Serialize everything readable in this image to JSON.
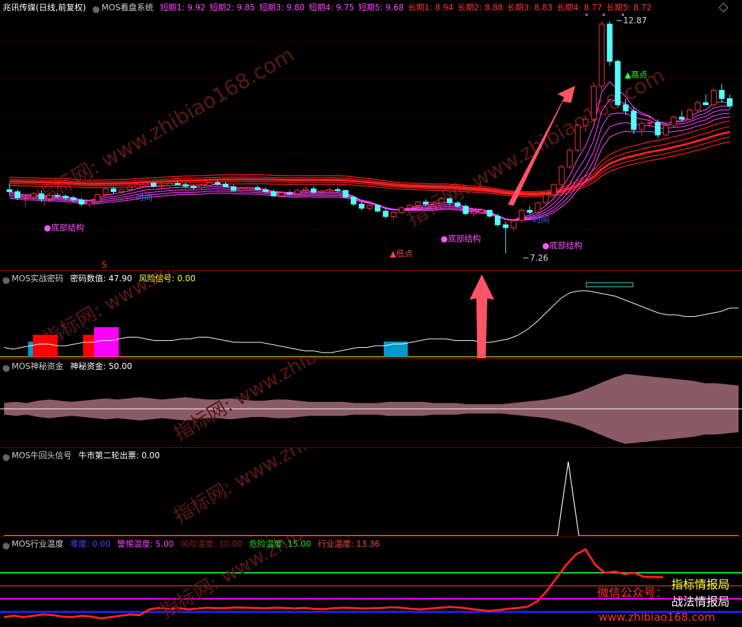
{
  "title": {
    "stock": "兆讯传媒(日线,前复权)",
    "indicator": "MOS看盘系统"
  },
  "ma_labels": [
    {
      "label": "短期1: 9.92",
      "color": "#ff44ff"
    },
    {
      "label": "短期2: 9.85",
      "color": "#ff44ff"
    },
    {
      "label": "短期3: 9.80",
      "color": "#ff44ff"
    },
    {
      "label": "短期4: 9.75",
      "color": "#ff44ff"
    },
    {
      "label": "短期5: 9.68",
      "color": "#ff44ff"
    },
    {
      "label": "长期1: 8.94",
      "color": "#ff3333"
    },
    {
      "label": "长期2: 8.88",
      "color": "#ff3333"
    },
    {
      "label": "长期3: 8.83",
      "color": "#ff3333"
    },
    {
      "label": "长期4: 8.77",
      "color": "#ff3333"
    },
    {
      "label": "长期5: 8.72",
      "color": "#ff3333"
    }
  ],
  "annotations": {
    "high_value": "12.87",
    "low_value": "7.26",
    "high_point": "▲高点",
    "low_point": "▲低点",
    "bottom_structure": "●底部结构",
    "time_label": "时间",
    "s_mark": "S"
  },
  "panels": {
    "p2": {
      "name": "MOS实战密码",
      "l1": "密码数值: 47.90",
      "l2": "风险信号: 0.00"
    },
    "p3": {
      "name": "MOS神秘资金",
      "l1": "神秘资金: 50.00"
    },
    "p4": {
      "name": "MOS牛回头信号",
      "l1": "牛市第二轮出票: 0.00"
    },
    "p5": {
      "name": "MOS行业温度",
      "l1": "零度: 0.00",
      "l2": "警惕温度: 5.00",
      "l3": "风险温度: 10.00",
      "l4": "危险温度: 15.00",
      "l5": "行业温度: 13.36"
    }
  },
  "watermarks": {
    "main": "指标网: www.zhibiao168.com",
    "wechat": "微信公众号：",
    "brand1": "指标情报局",
    "brand2": "战法情报局",
    "url": "www.zhibiao168.com"
  },
  "colors": {
    "up": "#ff3333",
    "down": "#54fcfc",
    "short_ma": "#ff44ff",
    "long_ma": "#ff2020",
    "bg": "#000000"
  },
  "chart_data": [
    {
      "type": "candlestick",
      "candles_ohlc": [
        [
          8.8,
          8.95,
          8.65,
          8.75
        ],
        [
          8.75,
          8.8,
          8.55,
          8.6
        ],
        [
          8.6,
          8.7,
          8.4,
          8.62
        ],
        [
          8.62,
          8.75,
          8.55,
          8.7
        ],
        [
          8.7,
          8.78,
          8.5,
          8.58
        ],
        [
          8.58,
          8.7,
          8.52,
          8.66
        ],
        [
          8.66,
          8.72,
          8.6,
          8.64
        ],
        [
          8.64,
          8.68,
          8.55,
          8.6
        ],
        [
          8.6,
          8.65,
          8.5,
          8.55
        ],
        [
          8.55,
          8.6,
          8.4,
          8.45
        ],
        [
          8.45,
          8.55,
          8.38,
          8.52
        ],
        [
          8.52,
          8.7,
          8.48,
          8.68
        ],
        [
          8.68,
          8.85,
          8.64,
          8.82
        ],
        [
          8.82,
          8.86,
          8.7,
          8.75
        ],
        [
          8.75,
          8.82,
          8.72,
          8.8
        ],
        [
          8.8,
          8.9,
          8.76,
          8.86
        ],
        [
          8.86,
          8.95,
          8.82,
          8.92
        ],
        [
          8.92,
          9.0,
          8.88,
          8.96
        ],
        [
          8.96,
          8.98,
          8.85,
          8.88
        ],
        [
          8.88,
          8.95,
          8.8,
          8.9
        ],
        [
          8.9,
          8.98,
          8.86,
          8.95
        ],
        [
          8.95,
          9.0,
          8.9,
          8.92
        ],
        [
          8.92,
          8.96,
          8.85,
          8.88
        ],
        [
          8.88,
          8.92,
          8.8,
          8.85
        ],
        [
          8.85,
          8.95,
          8.8,
          8.9
        ],
        [
          8.9,
          9.0,
          8.86,
          8.97
        ],
        [
          8.97,
          9.02,
          8.9,
          8.93
        ],
        [
          8.93,
          8.98,
          8.85,
          8.87
        ],
        [
          8.87,
          8.92,
          8.75,
          8.78
        ],
        [
          8.78,
          8.85,
          8.74,
          8.82
        ],
        [
          8.82,
          8.88,
          8.78,
          8.85
        ],
        [
          8.85,
          8.9,
          8.78,
          8.8
        ],
        [
          8.8,
          8.85,
          8.72,
          8.75
        ],
        [
          8.75,
          8.8,
          8.62,
          8.65
        ],
        [
          8.65,
          8.75,
          8.6,
          8.72
        ],
        [
          8.72,
          8.78,
          8.66,
          8.7
        ],
        [
          8.7,
          8.82,
          8.68,
          8.78
        ],
        [
          8.78,
          8.86,
          8.74,
          8.82
        ],
        [
          8.82,
          8.88,
          8.7,
          8.74
        ],
        [
          8.74,
          8.8,
          8.68,
          8.77
        ],
        [
          8.77,
          8.85,
          8.72,
          8.8
        ],
        [
          8.8,
          8.86,
          8.74,
          8.78
        ],
        [
          8.78,
          8.8,
          8.6,
          8.62
        ],
        [
          8.62,
          8.66,
          8.4,
          8.45
        ],
        [
          8.45,
          8.5,
          8.3,
          8.35
        ],
        [
          8.35,
          8.48,
          8.3,
          8.42
        ],
        [
          8.42,
          8.45,
          8.25,
          8.28
        ],
        [
          8.28,
          8.32,
          8.1,
          8.15
        ],
        [
          8.15,
          8.28,
          8.08,
          8.25
        ],
        [
          8.25,
          8.4,
          8.2,
          8.36
        ],
        [
          8.36,
          8.46,
          8.3,
          8.42
        ],
        [
          8.42,
          8.52,
          8.38,
          8.5
        ],
        [
          8.5,
          8.55,
          8.4,
          8.45
        ],
        [
          8.45,
          8.52,
          8.38,
          8.48
        ],
        [
          8.48,
          8.62,
          8.44,
          8.58
        ],
        [
          8.58,
          8.62,
          8.45,
          8.48
        ],
        [
          8.48,
          8.52,
          8.36,
          8.4
        ],
        [
          8.4,
          8.44,
          8.18,
          8.22
        ],
        [
          8.22,
          8.3,
          8.15,
          8.26
        ],
        [
          8.26,
          8.34,
          8.2,
          8.3
        ],
        [
          8.3,
          8.32,
          8.12,
          8.16
        ],
        [
          8.16,
          8.22,
          7.9,
          7.95
        ],
        [
          7.95,
          8.02,
          7.26,
          7.88
        ],
        [
          7.88,
          8.1,
          7.8,
          8.05
        ],
        [
          8.05,
          8.35,
          8.0,
          8.3
        ],
        [
          8.3,
          8.4,
          8.2,
          8.25
        ],
        [
          8.25,
          8.5,
          8.2,
          8.48
        ],
        [
          8.48,
          8.7,
          8.44,
          8.68
        ],
        [
          8.68,
          8.95,
          8.62,
          8.92
        ],
        [
          8.92,
          9.4,
          8.88,
          9.35
        ],
        [
          9.35,
          9.8,
          9.3,
          9.75
        ],
        [
          9.75,
          10.4,
          9.7,
          10.35
        ],
        [
          10.35,
          10.6,
          10.2,
          10.5
        ],
        [
          10.5,
          11.4,
          10.45,
          11.3
        ],
        [
          11.3,
          12.87,
          11.2,
          12.8
        ],
        [
          12.8,
          12.87,
          11.8,
          11.9
        ],
        [
          11.9,
          11.95,
          10.8,
          10.85
        ],
        [
          10.85,
          11.0,
          10.6,
          10.7
        ],
        [
          10.7,
          10.8,
          10.15,
          10.25
        ],
        [
          10.25,
          10.45,
          10.1,
          10.4
        ],
        [
          10.4,
          10.55,
          10.3,
          10.42
        ],
        [
          10.42,
          10.5,
          10.05,
          10.12
        ],
        [
          10.12,
          10.4,
          10.08,
          10.35
        ],
        [
          10.35,
          10.6,
          10.3,
          10.55
        ],
        [
          10.55,
          10.7,
          10.45,
          10.5
        ],
        [
          10.5,
          10.78,
          10.46,
          10.72
        ],
        [
          10.72,
          10.95,
          10.68,
          10.9
        ],
        [
          10.9,
          11.1,
          10.85,
          10.85
        ],
        [
          10.85,
          11.25,
          10.8,
          11.2
        ],
        [
          11.2,
          11.35,
          10.9,
          11.0
        ],
        [
          11.0,
          11.1,
          10.75,
          10.82
        ]
      ]
    },
    {
      "type": "line",
      "series": [
        {
          "name": "密码数值",
          "values": [
            5,
            4,
            5,
            6,
            7,
            7,
            6,
            6,
            7,
            8,
            8,
            9,
            9,
            10,
            11,
            11,
            10,
            9,
            9,
            9,
            10,
            10,
            11,
            11,
            10,
            9,
            8,
            8,
            8,
            8,
            7,
            6,
            5,
            4,
            3,
            3,
            2,
            2,
            3,
            4,
            5,
            5,
            6,
            6,
            7,
            7,
            8,
            9,
            10,
            10,
            10,
            9,
            9,
            9,
            8,
            8,
            9,
            10,
            12,
            15,
            19,
            24,
            29,
            34,
            37,
            38,
            38,
            37,
            36,
            35,
            33,
            31,
            29,
            27,
            25,
            24,
            24,
            23,
            23,
            24,
            25,
            26,
            28,
            28
          ]
        },
        {
          "name": "风险信号",
          "values": [
            0,
            0,
            0,
            0,
            0,
            0,
            0,
            0,
            0,
            0,
            0,
            0,
            0,
            0,
            0,
            0,
            0,
            0,
            0,
            0,
            0,
            0,
            0,
            0,
            0,
            0,
            0,
            0,
            0,
            0,
            0,
            0,
            0,
            0,
            0,
            0,
            0,
            0,
            0,
            0,
            0,
            0,
            0,
            0,
            0,
            0,
            0,
            0,
            0,
            0,
            0,
            0,
            0,
            0,
            0,
            0,
            0,
            0,
            0,
            0,
            0,
            0,
            0,
            0,
            0,
            0,
            0,
            0,
            0,
            0,
            0,
            0,
            0,
            0,
            0,
            0,
            0,
            0,
            0,
            0,
            0,
            0,
            0,
            0
          ]
        }
      ]
    },
    {
      "type": "area",
      "series": [
        {
          "name": "神秘资金",
          "values": [
            5,
            6,
            5,
            7,
            8,
            7,
            6,
            7,
            8,
            9,
            8,
            9,
            10,
            9,
            8,
            9,
            10,
            9,
            8,
            8,
            9,
            8,
            7,
            7,
            8,
            8,
            7,
            6,
            6,
            6,
            6,
            5,
            5,
            5,
            6,
            6,
            6,
            6,
            5,
            5,
            5,
            4,
            4,
            4,
            4,
            5,
            6,
            7,
            8,
            10,
            12,
            15,
            19,
            23,
            27,
            30,
            29,
            28,
            27,
            26,
            25,
            24,
            22,
            22,
            21,
            20
          ]
        }
      ]
    },
    {
      "type": "line",
      "series": [
        {
          "name": "牛市第二轮出票",
          "values": [
            0,
            0,
            0,
            0,
            0,
            0,
            0,
            0,
            0,
            0,
            0,
            0,
            0,
            0,
            0,
            0,
            0,
            0,
            0,
            0,
            0,
            0,
            0,
            0,
            0,
            0,
            0,
            0,
            0,
            0,
            0,
            0,
            0,
            0,
            0,
            0,
            0,
            0,
            0,
            0,
            0,
            0,
            0,
            0,
            0,
            0,
            0,
            0,
            0,
            0,
            0,
            0,
            0,
            1,
            0,
            0,
            0,
            0,
            0,
            0,
            0,
            0,
            0,
            0,
            0,
            0,
            0,
            0,
            0,
            0
          ]
        }
      ]
    },
    {
      "type": "line",
      "hlines": [
        {
          "name": "零度",
          "value": 0,
          "color": "#2222ff"
        },
        {
          "name": "警惕温度",
          "value": 5,
          "color": "#ff00ff"
        },
        {
          "name": "风险温度",
          "value": 10,
          "color": "#8b2222"
        },
        {
          "name": "危险温度",
          "value": 15,
          "color": "#22dd22"
        }
      ],
      "series": [
        {
          "name": "行业温度",
          "values": [
            -2,
            -1.5,
            -2,
            -1.5,
            -1,
            -1.2,
            -1.8,
            -2,
            -1.5,
            -1.8,
            -2.5,
            -2,
            -1.5,
            -1,
            -1.2,
            1,
            1.5,
            1.2,
            1.4,
            1,
            1.3,
            1.6,
            1.4,
            1.5,
            1.7,
            1.6,
            1.5,
            1.4,
            1.6,
            1.5,
            1.3,
            1.5,
            1.2,
            1.1,
            1.4,
            1.6,
            1.5,
            1.3,
            1.4,
            1.5,
            1.8,
            1.6,
            1.2,
            1.0,
            1.3,
            1.6,
            1.9,
            1.7,
            1.2,
            0.8,
            0.4,
            0.7,
            1.2,
            1.5,
            2,
            4,
            8,
            13,
            18,
            22,
            24,
            18,
            15,
            15.5,
            14.5,
            15,
            13.5,
            13.4,
            13.36
          ]
        }
      ]
    }
  ]
}
